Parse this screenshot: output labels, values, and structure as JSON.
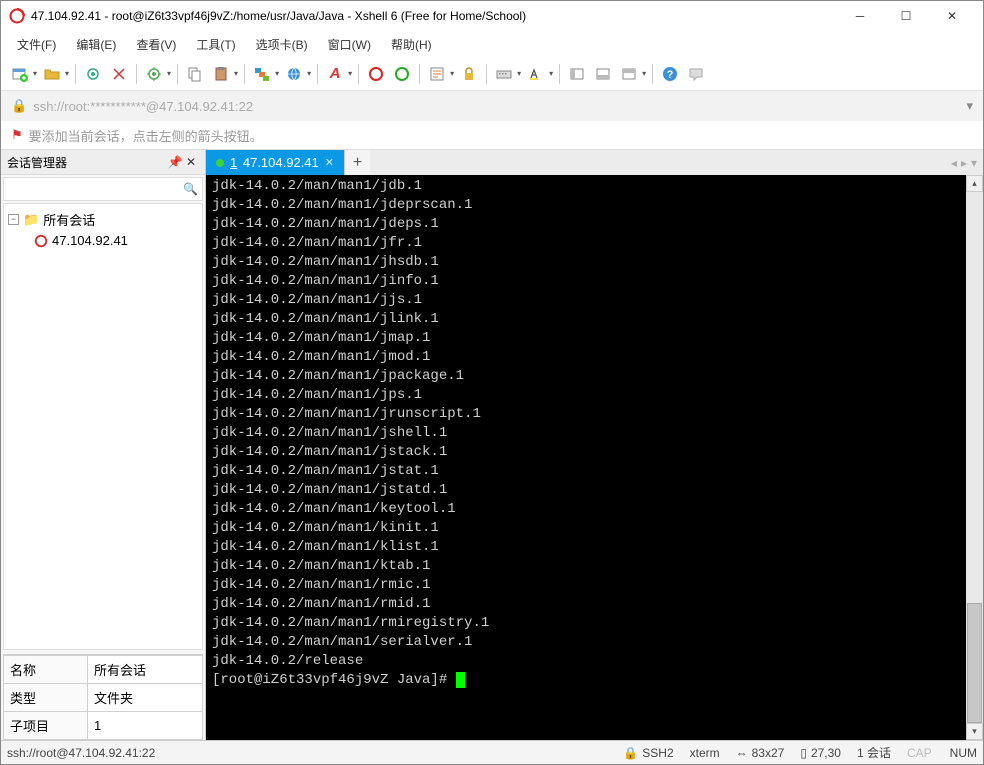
{
  "window": {
    "title": "47.104.92.41 - root@iZ6t33vpf46j9vZ:/home/usr/Java/Java - Xshell 6 (Free for Home/School)"
  },
  "menus": [
    "文件(F)",
    "编辑(E)",
    "查看(V)",
    "工具(T)",
    "选项卡(B)",
    "窗口(W)",
    "帮助(H)"
  ],
  "addressbar": {
    "text": "ssh://root:***********@47.104.92.41:22"
  },
  "hint": "要添加当前会话，点击左侧的箭头按钮。",
  "sidebar": {
    "title": "会话管理器",
    "search_placeholder": "",
    "root": "所有会话",
    "session": "47.104.92.41",
    "props": [
      {
        "k": "名称",
        "v": "所有会话"
      },
      {
        "k": "类型",
        "v": "文件夹"
      },
      {
        "k": "子项目",
        "v": "1"
      }
    ]
  },
  "tab": {
    "num": "1",
    "label": "47.104.92.41"
  },
  "terminal_lines": [
    "jdk-14.0.2/man/man1/jdb.1",
    "jdk-14.0.2/man/man1/jdeprscan.1",
    "jdk-14.0.2/man/man1/jdeps.1",
    "jdk-14.0.2/man/man1/jfr.1",
    "jdk-14.0.2/man/man1/jhsdb.1",
    "jdk-14.0.2/man/man1/jinfo.1",
    "jdk-14.0.2/man/man1/jjs.1",
    "jdk-14.0.2/man/man1/jlink.1",
    "jdk-14.0.2/man/man1/jmap.1",
    "jdk-14.0.2/man/man1/jmod.1",
    "jdk-14.0.2/man/man1/jpackage.1",
    "jdk-14.0.2/man/man1/jps.1",
    "jdk-14.0.2/man/man1/jrunscript.1",
    "jdk-14.0.2/man/man1/jshell.1",
    "jdk-14.0.2/man/man1/jstack.1",
    "jdk-14.0.2/man/man1/jstat.1",
    "jdk-14.0.2/man/man1/jstatd.1",
    "jdk-14.0.2/man/man1/keytool.1",
    "jdk-14.0.2/man/man1/kinit.1",
    "jdk-14.0.2/man/man1/klist.1",
    "jdk-14.0.2/man/man1/ktab.1",
    "jdk-14.0.2/man/man1/rmic.1",
    "jdk-14.0.2/man/man1/rmid.1",
    "jdk-14.0.2/man/man1/rmiregistry.1",
    "jdk-14.0.2/man/man1/serialver.1",
    "jdk-14.0.2/release"
  ],
  "prompt": "[root@iZ6t33vpf46j9vZ Java]# ",
  "status": {
    "conn": "ssh://root@47.104.92.41:22",
    "proto": "SSH2",
    "term": "xterm",
    "size": "83x27",
    "pos": "27,30",
    "sessions": "1 会话",
    "cap": "CAP",
    "num": "NUM"
  },
  "colors": {
    "tab_active": "#0b99e6",
    "terminal_bg": "#000000",
    "terminal_fg": "#d0d0d0",
    "cursor": "#00ff00"
  }
}
